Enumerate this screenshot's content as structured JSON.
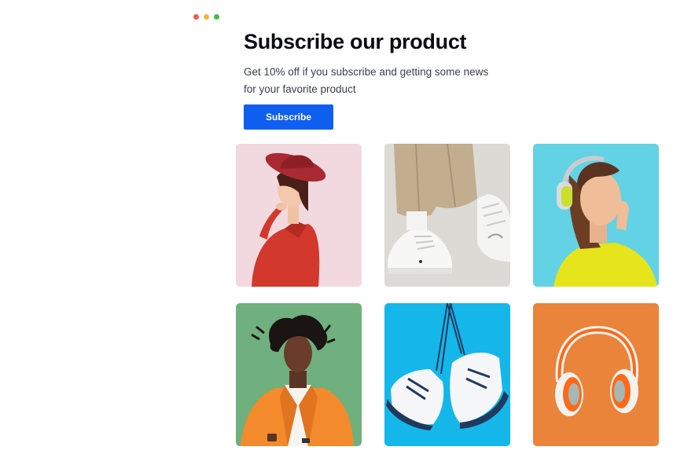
{
  "window": {
    "controls": [
      {
        "name": "close",
        "color": "#ee5a52"
      },
      {
        "name": "minimize",
        "color": "#f2b731"
      },
      {
        "name": "maximize",
        "color": "#3fbe4a"
      }
    ]
  },
  "hero": {
    "title": "Subscribe our product",
    "subtitle": "Get 10% off if you subscribe and getting some news for your favorite product",
    "button_label": "Subscribe",
    "accent": "#0e5ff0"
  },
  "gallery": {
    "images": [
      {
        "subject": "woman-red-hat-photo",
        "background": "#f1d9df"
      },
      {
        "subject": "white-sneakers-walking-photo",
        "background": "#dcdad5"
      },
      {
        "subject": "woman-headphones-yellow-sweater-photo",
        "background": "#63d2e5"
      },
      {
        "subject": "man-orange-blazer-photo",
        "background": "#6fb07e"
      },
      {
        "subject": "hanging-sneakers-photo",
        "background": "#15b6ea"
      },
      {
        "subject": "orange-headphones-photo",
        "background": "#e9843a"
      }
    ]
  }
}
